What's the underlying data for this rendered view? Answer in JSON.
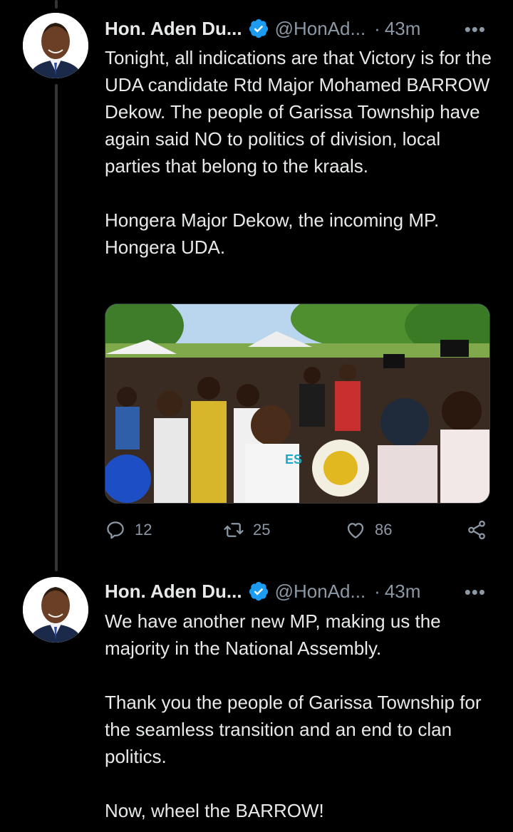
{
  "tweets": [
    {
      "display_name": "Hon. Aden Du...",
      "handle": "@HonAd...",
      "dot": "·",
      "time": "43m",
      "more": "•••",
      "text": "Tonight, all indications are that Victory is for the UDA candidate Rtd Major Mohamed BARROW Dekow. The people of Garissa Township have again said NO to politics of division, local parties that belong to the kraals.\n\nHongera Major Dekow, the incoming MP. Hongera UDA.",
      "media_sign_text": "ES",
      "actions": {
        "reply_count": "12",
        "retweet_count": "25",
        "like_count": "86"
      }
    },
    {
      "display_name": "Hon. Aden Du...",
      "handle": "@HonAd...",
      "dot": "·",
      "time": "43m",
      "more": "•••",
      "text": "We have another new MP, making us the majority in the National Assembly.\n\nThank you the people of Garissa Township for the seamless transition and an end to clan politics.\n\nNow, wheel the BARROW!"
    }
  ],
  "colors": {
    "background": "#000000",
    "text": "#e7e9ea",
    "secondary": "#8b98a5",
    "verified_badge": "#1d9bf0",
    "thread_line": "#333639"
  }
}
